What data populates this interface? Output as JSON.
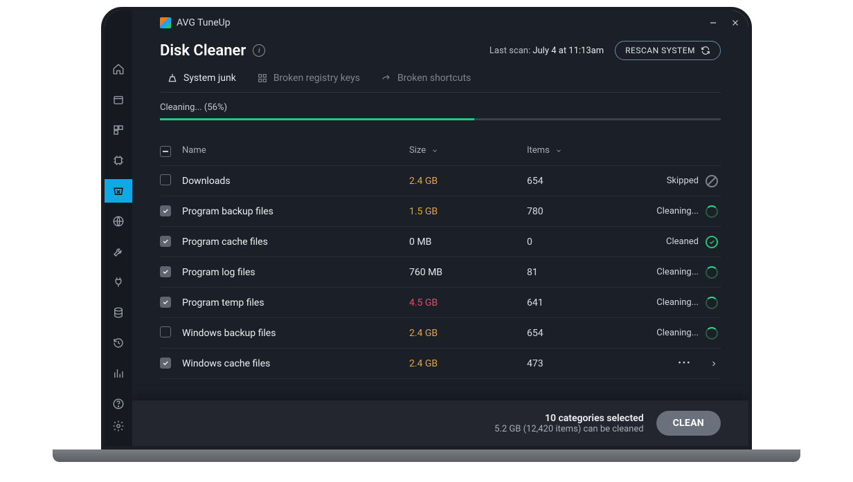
{
  "app_title": "AVG TuneUp",
  "page_title": "Disk Cleaner",
  "last_scan": {
    "label": "Last scan:",
    "value": "July 4 at 11:13am"
  },
  "rescan_label": "RESCAN SYSTEM",
  "tabs": [
    {
      "label": "System junk"
    },
    {
      "label": "Broken registry keys"
    },
    {
      "label": "Broken shortcuts"
    }
  ],
  "progress": {
    "label": "Cleaning... (56%)",
    "percent": 56
  },
  "table": {
    "headers": {
      "name": "Name",
      "size": "Size",
      "items": "Items"
    },
    "rows": [
      {
        "checked": false,
        "name": "Downloads",
        "size": "2.4 GB",
        "size_color": "orange",
        "items": "654",
        "status": "Skipped",
        "status_type": "skipped"
      },
      {
        "checked": true,
        "name": "Program backup files",
        "size": "1.5 GB",
        "size_color": "orange",
        "items": "780",
        "status": "Cleaning...",
        "status_type": "spinner"
      },
      {
        "checked": true,
        "name": "Program cache files",
        "size": "0 MB",
        "size_color": "default",
        "items": "0",
        "status": "Cleaned",
        "status_type": "check"
      },
      {
        "checked": true,
        "name": "Program log files",
        "size": "760 MB",
        "size_color": "default",
        "items": "81",
        "status": "Cleaning...",
        "status_type": "spinner"
      },
      {
        "checked": true,
        "name": "Program temp files",
        "size": "4.5 GB",
        "size_color": "red",
        "items": "641",
        "status": "Cleaning...",
        "status_type": "spinner"
      },
      {
        "checked": false,
        "name": "Windows backup files",
        "size": "2.4 GB",
        "size_color": "orange",
        "items": "654",
        "status": "Cleaning...",
        "status_type": "spinner"
      },
      {
        "checked": true,
        "name": "Windows cache files",
        "size": "2.4 GB",
        "size_color": "orange",
        "items": "473",
        "status": "",
        "status_type": "more"
      }
    ]
  },
  "footer": {
    "title": "10 categories selected",
    "sub": "5.2 GB (12,420 items) can be cleaned",
    "button": "CLEAN"
  },
  "sidebar_icons": [
    "home-icon",
    "drive-icon",
    "apps-icon",
    "cpu-icon",
    "trash-icon",
    "globe-icon",
    "wrench-icon",
    "plug-icon",
    "database-icon",
    "history-icon",
    "chart-icon",
    "help-icon"
  ],
  "active_sidebar_index": 4
}
